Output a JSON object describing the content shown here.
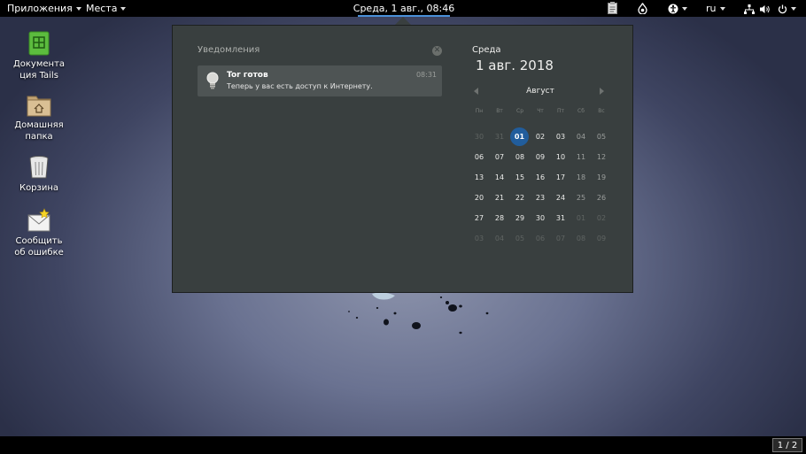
{
  "topbar": {
    "applications_label": "Приложения",
    "places_label": "Места",
    "clock_label": "Среда, 1 авг., 08:46",
    "keyboard_layout": "ru",
    "icons": [
      "clipboard-icon",
      "onion-icon",
      "accessibility-icon",
      "network-icon",
      "volume-icon",
      "power-icon"
    ]
  },
  "desktop": {
    "items": [
      {
        "label_line1": "Документа",
        "label_line2": "ция Tails",
        "icon": "documentation-icon"
      },
      {
        "label_line1": "Домашняя",
        "label_line2": "папка",
        "icon": "home-folder-icon"
      },
      {
        "label_line1": "Корзина",
        "label_line2": "",
        "icon": "trash-icon"
      },
      {
        "label_line1": "Сообщить",
        "label_line2": "об ошибке",
        "icon": "bug-report-icon"
      }
    ]
  },
  "notifications": {
    "header": "Уведомления",
    "items": [
      {
        "title": "Tor готов",
        "body": "Теперь у вас есть доступ к Интернету.",
        "time": "08:31",
        "icon": "lightbulb-icon"
      }
    ]
  },
  "calendar": {
    "weekday_full": "Среда",
    "date_full": "1 авг. 2018",
    "month": "Август",
    "weekdays": [
      "Пн",
      "Вт",
      "Ср",
      "Чт",
      "Пт",
      "Сб",
      "Вс"
    ],
    "weeks": [
      [
        "30",
        "31",
        "01",
        "02",
        "03",
        "04",
        "05"
      ],
      [
        "06",
        "07",
        "08",
        "09",
        "10",
        "11",
        "12"
      ],
      [
        "13",
        "14",
        "15",
        "16",
        "17",
        "18",
        "19"
      ],
      [
        "20",
        "21",
        "22",
        "23",
        "24",
        "25",
        "26"
      ],
      [
        "27",
        "28",
        "29",
        "30",
        "31",
        "01",
        "02"
      ],
      [
        "03",
        "04",
        "05",
        "06",
        "07",
        "08",
        "09"
      ]
    ],
    "today": "01"
  },
  "bottombar": {
    "workspace": "1 / 2"
  },
  "colors": {
    "accent": "#215d9c",
    "popover_bg": "#393f3f",
    "topbar_bg": "#000000"
  }
}
